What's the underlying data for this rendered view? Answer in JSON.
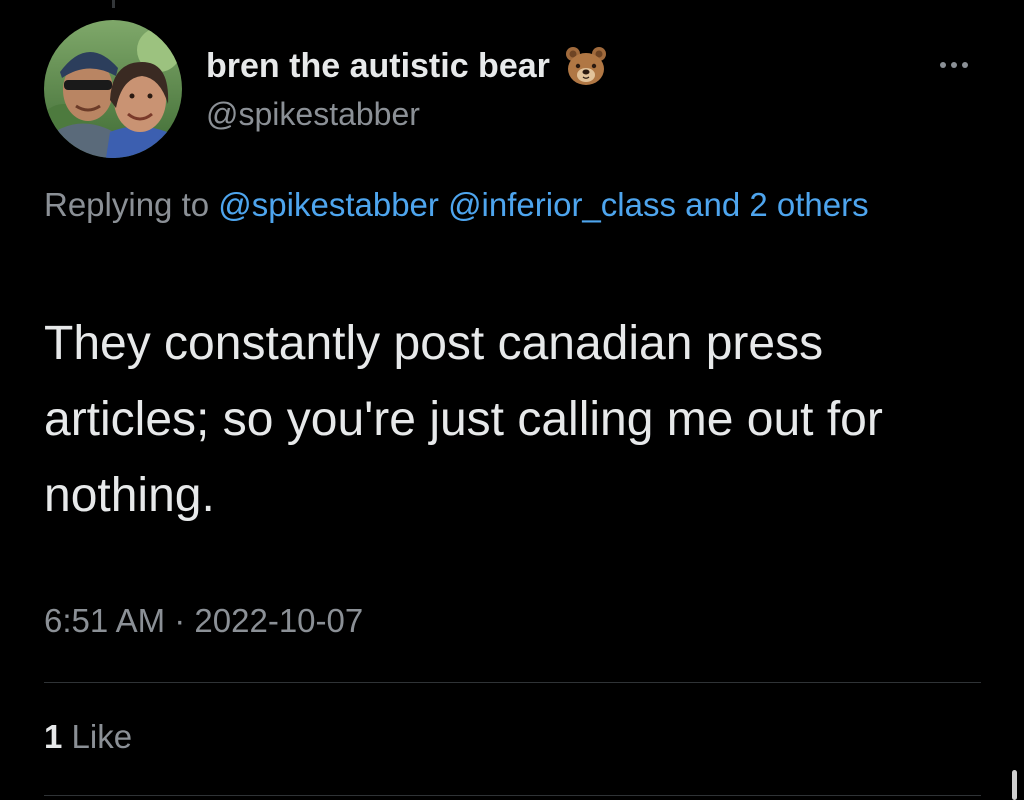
{
  "author": {
    "display_name": "bren the autistic bear",
    "name_emoji": "bear-face-icon",
    "handle": "@spikestabber"
  },
  "reply_context": {
    "prefix": "Replying to",
    "mention_1": "@spikestabber",
    "mention_2": "@inferior_class",
    "others": "and 2 others"
  },
  "tweet": {
    "text": "They constantly post canadian press articles; so you're just calling me out for nothing.",
    "time": "6:51 AM",
    "separator": "·",
    "date": "2022-10-07"
  },
  "engagement": {
    "like_count": "1",
    "like_label": "Like"
  },
  "colors": {
    "background": "#000000",
    "text": "#e7e9ea",
    "muted": "#8b9096",
    "link": "#4ea5ee",
    "divider": "#2f3336"
  }
}
